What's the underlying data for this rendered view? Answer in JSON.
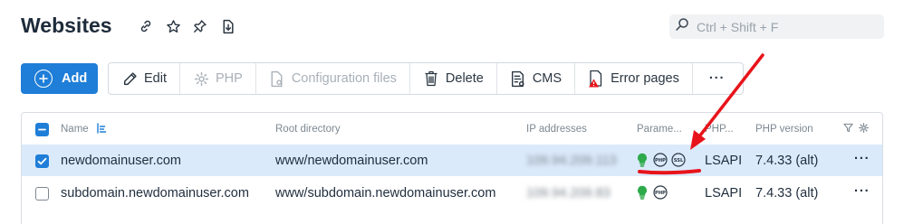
{
  "page": {
    "title": "Websites"
  },
  "search": {
    "placeholder": "Ctrl + Shift + F"
  },
  "toolbar": {
    "add_label": "Add",
    "edit_label": "Edit",
    "php_label": "PHP",
    "config_label": "Configuration files",
    "delete_label": "Delete",
    "cms_label": "CMS",
    "error_pages_label": "Error pages",
    "more_label": "···"
  },
  "table": {
    "columns": {
      "name": "Name",
      "root_directory": "Root directory",
      "ip_addresses": "IP addresses",
      "parameters": "Parame...",
      "php_mode": "PHP...",
      "php_version": "PHP version"
    },
    "rows": [
      {
        "name": "newdomainuser.com",
        "root_directory": "www/newdomainuser.com",
        "ip": "109.94.209.113",
        "php_mode": "LSAPI",
        "php_version": "7.4.33 (alt)",
        "selected": true,
        "badges": [
          "lightbulb-icon",
          "php-icon",
          "ssl-icon"
        ],
        "menu": "···"
      },
      {
        "name": "subdomain.newdomainuser.com",
        "root_directory": "www/subdomain.newdomainuser.com",
        "ip": "109.94.209.83",
        "php_mode": "LSAPI",
        "php_version": "7.4.33 (alt)",
        "selected": false,
        "badges": [
          "lightbulb-icon",
          "php-icon"
        ],
        "menu": "···"
      }
    ]
  },
  "colors": {
    "accent": "#1f7ed8",
    "selected_row": "#dbeafb",
    "badge_green": "#2eaa4a",
    "annotation_red": "#e8141b"
  }
}
